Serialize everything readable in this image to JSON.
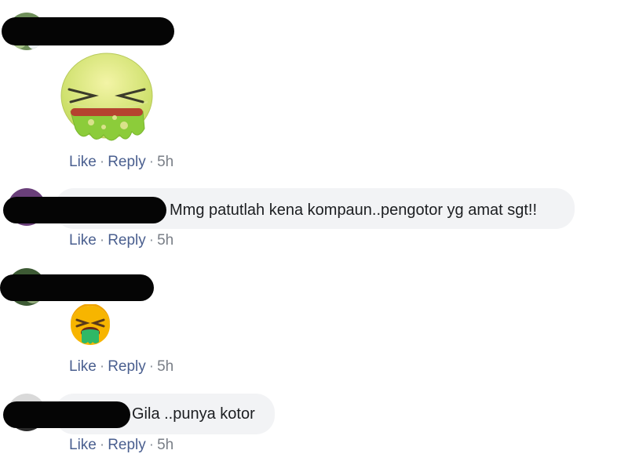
{
  "comments": [
    {
      "kind": "sticker",
      "sticker_icon": "vomiting-face-sticker",
      "actions": {
        "like": "Like",
        "reply": "Reply",
        "time": "5h"
      }
    },
    {
      "kind": "text",
      "text": "Mmg patutlah kena kompaun..pengotor yg amat sgt!!",
      "actions": {
        "like": "Like",
        "reply": "Reply",
        "time": "5h"
      }
    },
    {
      "kind": "emoji",
      "emoji_icon": "nauseated-face-emoji",
      "actions": {
        "like": "Like",
        "reply": "Reply",
        "time": "5h"
      }
    },
    {
      "kind": "text",
      "text": "Gila ..punya kotor",
      "actions": {
        "like": "Like",
        "reply": "Reply",
        "time": "5h"
      }
    }
  ],
  "separator": "·",
  "colors": {
    "link": "#4a5f8f",
    "bubble": "#f2f3f5",
    "redaction": "#050505"
  }
}
